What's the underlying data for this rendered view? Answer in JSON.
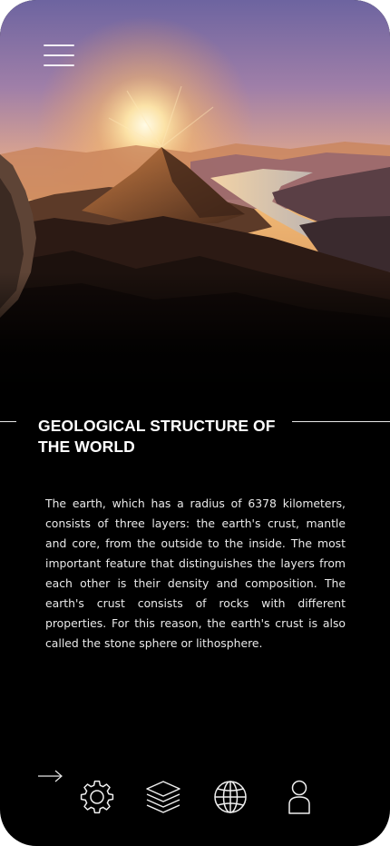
{
  "header": {
    "menu_icon": "hamburger-menu-icon",
    "hero_image": "mountain-sunset-landscape"
  },
  "article": {
    "title": "GEOLOGICAL STRUCTURE OF THE WORLD",
    "body": "The earth, which has a radius of 6378 kilometers, consists of three layers: the earth's crust, mantle and core, from the outside to the inside. The most important feature that distinguishes the layers from each other is their density and composition. The earth's crust consists of rocks with different properties. For this reason, the earth's crust is also called the stone sphere or lithosphere."
  },
  "bottom_nav": {
    "arrow_icon": "arrow-right-icon",
    "items": [
      {
        "icon": "gear-icon"
      },
      {
        "icon": "layers-icon"
      },
      {
        "icon": "globe-icon"
      },
      {
        "icon": "user-icon"
      }
    ]
  },
  "colors": {
    "background": "#000000",
    "text": "#ffffff",
    "sky_top": "#7f6fa6",
    "sun": "#ffd48a"
  }
}
